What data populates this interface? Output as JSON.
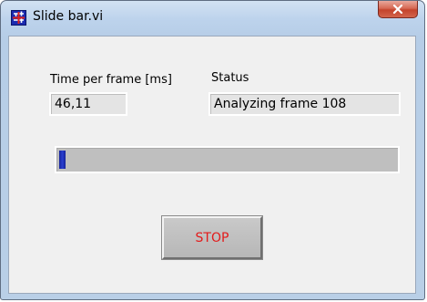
{
  "window": {
    "title": "Slide bar.vi",
    "close_icon": "close-icon"
  },
  "fields": {
    "time_per_frame": {
      "label": "Time per frame [ms]",
      "value": "46,11"
    },
    "status": {
      "label": "Status",
      "value": "Analyzing frame 108"
    }
  },
  "progress": {
    "fraction": 0.02,
    "fill_color": "#2a3fd0"
  },
  "stop_button": {
    "label": "STOP",
    "text_color": "#e31b1b"
  }
}
